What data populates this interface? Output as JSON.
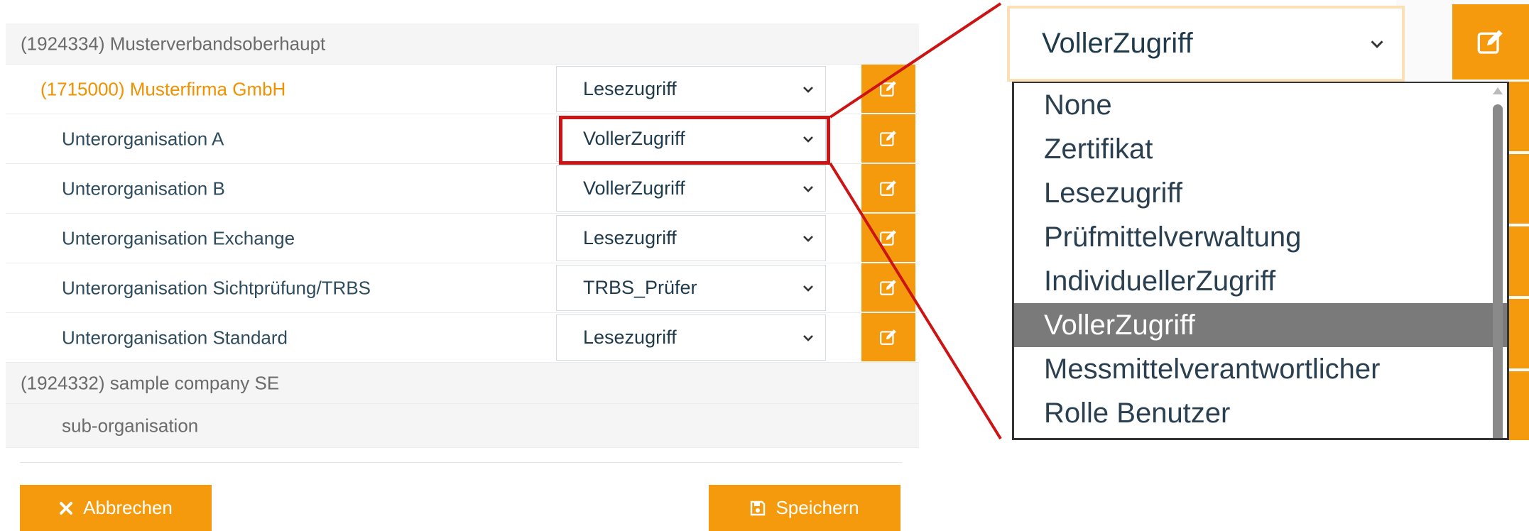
{
  "tree": {
    "company1": {
      "label": "(1924334) Musterverbandsoberhaupt"
    },
    "company1_child": {
      "label": "(1715000) Musterfirma GmbH",
      "value": "Lesezugriff"
    },
    "subs": [
      {
        "label": "Unterorganisation A",
        "value": "VollerZugriff"
      },
      {
        "label": "Unterorganisation B",
        "value": "VollerZugriff"
      },
      {
        "label": "Unterorganisation Exchange",
        "value": "Lesezugriff"
      },
      {
        "label": "Unterorganisation Sichtprüfung/TRBS",
        "value": "TRBS_Prüfer"
      },
      {
        "label": "Unterorganisation Standard",
        "value": "Lesezugriff"
      }
    ],
    "company2": {
      "label": "(1924332) sample company SE"
    },
    "company2_child": {
      "label": "sub-organisation"
    }
  },
  "actions": {
    "cancel_label": "Abbrechen",
    "save_label": "Speichern"
  },
  "zoom": {
    "selected_value": "VollerZugriff",
    "options": [
      "None",
      "Zertifikat",
      "Lesezugriff",
      "Prüfmittelverwaltung",
      "IndividuellerZugriff",
      "VollerZugriff",
      "Messmittelverantwortlicher",
      "Rolle Benutzer"
    ],
    "highlighted_index": 5
  },
  "colors": {
    "accent": "#f59a0c",
    "highlight": "#cc1414",
    "selected_option_bg": "#7a7a7a"
  },
  "icons": {
    "edit": "edit-icon",
    "cancel": "close-icon",
    "save": "floppy-disk-icon",
    "dropdown": "chevron-down-icon"
  }
}
